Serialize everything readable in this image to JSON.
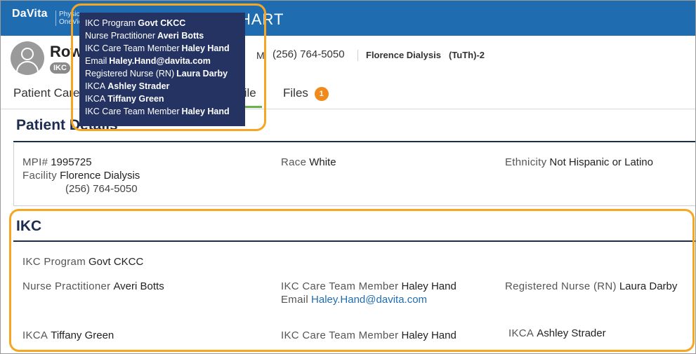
{
  "header": {
    "logo": "DaVita",
    "logo_sub_1": "Physic",
    "logo_sub_2": "OneView",
    "app_title": "HART"
  },
  "patient": {
    "name": "Row",
    "badge": "IKC",
    "label_m": "M",
    "phone": "(256) 764-5050",
    "facility": "Florence Dialysis",
    "schedule": "(TuTh)-2"
  },
  "tabs": [
    {
      "label": "Patient Care"
    },
    {
      "label": "file"
    },
    {
      "label": "Files",
      "count": "1"
    }
  ],
  "tooltip": [
    {
      "label": "IKC Program",
      "value": "Govt CKCC"
    },
    {
      "label": "Nurse Practitioner",
      "value": "Averi Botts"
    },
    {
      "label": "IKC Care Team Member",
      "value": "Haley Hand"
    },
    {
      "label": "Email",
      "value": "Haley.Hand@davita.com"
    },
    {
      "label": "Registered Nurse (RN)",
      "value": "Laura Darby"
    },
    {
      "label": "IKCA",
      "value": "Ashley Strader"
    },
    {
      "label": "IKCA",
      "value": "Tiffany Green"
    },
    {
      "label": "IKC Care Team Member",
      "value": "Haley Hand"
    }
  ],
  "patient_details": {
    "title": "Patient Details",
    "mpi_label": "MPI#",
    "mpi_value": "1995725",
    "facility_label": "Facility",
    "facility_value": "Florence Dialysis",
    "facility_phone": "(256) 764-5050",
    "race_label": "Race",
    "race_value": "White",
    "ethnicity_label": "Ethnicity",
    "ethnicity_value": "Not Hispanic or Latino"
  },
  "ikc": {
    "title": "IKC",
    "program_label": "IKC Program",
    "program_value": "Govt CKCC",
    "np_label": "Nurse Practitioner",
    "np_value": "Averi Botts",
    "ctm1_label": "IKC Care Team Member",
    "ctm1_value": "Haley Hand",
    "email_label": "Email",
    "email_value": "Haley.Hand@davita.com",
    "rn_label": "Registered Nurse (RN)",
    "rn_value": "Laura Darby",
    "ikca1_label": "IKCA",
    "ikca1_value": "Tiffany Green",
    "ctm2_label": "IKC Care Team Member",
    "ctm2_value": "Haley Hand",
    "ikca2_label": "IKCA",
    "ikca2_value": "Ashley Strader"
  },
  "colors": {
    "header_blue": "#1f6db0",
    "tooltip_navy": "#243362",
    "highlight_orange": "#f5a623",
    "badge_orange": "#f08a1c",
    "heading_navy": "#1d2d4f"
  }
}
